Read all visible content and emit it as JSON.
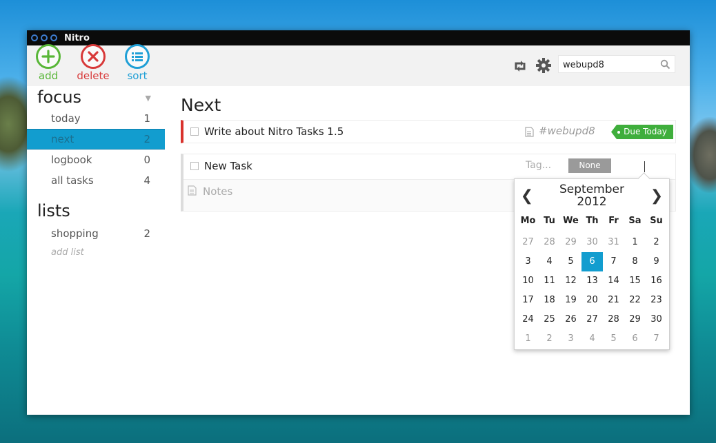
{
  "window": {
    "title": "Nitro"
  },
  "toolbar": {
    "add_label": "add",
    "delete_label": "delete",
    "sort_label": "sort",
    "search_value": "webupd8"
  },
  "sidebar": {
    "focus_heading": "focus",
    "focus_items": [
      {
        "label": "today",
        "count": "1"
      },
      {
        "label": "next",
        "count": "2",
        "active": true
      },
      {
        "label": "logbook",
        "count": "0"
      },
      {
        "label": "all tasks",
        "count": "4"
      }
    ],
    "lists_heading": "lists",
    "list_items": [
      {
        "label": "shopping",
        "count": "2"
      }
    ],
    "add_list": "add list"
  },
  "main": {
    "title": "Next",
    "task1": {
      "name": "Write about Nitro Tasks 1.5",
      "tag": "#webupd8",
      "due": "Due Today"
    },
    "task2": {
      "name": "New Task",
      "tag_placeholder": "Tag...",
      "priority": "None",
      "notes_placeholder": "Notes"
    }
  },
  "calendar": {
    "month": "September",
    "year": "2012",
    "weekdays": [
      "Mo",
      "Tu",
      "We",
      "Th",
      "Fr",
      "Sa",
      "Su"
    ],
    "weeks": [
      [
        "27",
        "28",
        "29",
        "30",
        "31",
        "1",
        "2"
      ],
      [
        "3",
        "4",
        "5",
        "6",
        "7",
        "8",
        "9"
      ],
      [
        "10",
        "11",
        "12",
        "13",
        "14",
        "15",
        "16"
      ],
      [
        "17",
        "18",
        "19",
        "20",
        "21",
        "22",
        "23"
      ],
      [
        "24",
        "25",
        "26",
        "27",
        "28",
        "29",
        "30"
      ],
      [
        "1",
        "2",
        "3",
        "4",
        "5",
        "6",
        "7"
      ]
    ],
    "selected_day": "6",
    "muted": [
      [
        0,
        0
      ],
      [
        0,
        1
      ],
      [
        0,
        2
      ],
      [
        0,
        3
      ],
      [
        0,
        4
      ],
      [
        5,
        0
      ],
      [
        5,
        1
      ],
      [
        5,
        2
      ],
      [
        5,
        3
      ],
      [
        5,
        4
      ],
      [
        5,
        5
      ],
      [
        5,
        6
      ]
    ]
  },
  "colors": {
    "accent": "#129dcf",
    "add": "#58b637",
    "delete": "#d83a3a",
    "sort": "#1f9fd6",
    "due": "#3fae3c",
    "priority_bar": "#d9322c"
  }
}
